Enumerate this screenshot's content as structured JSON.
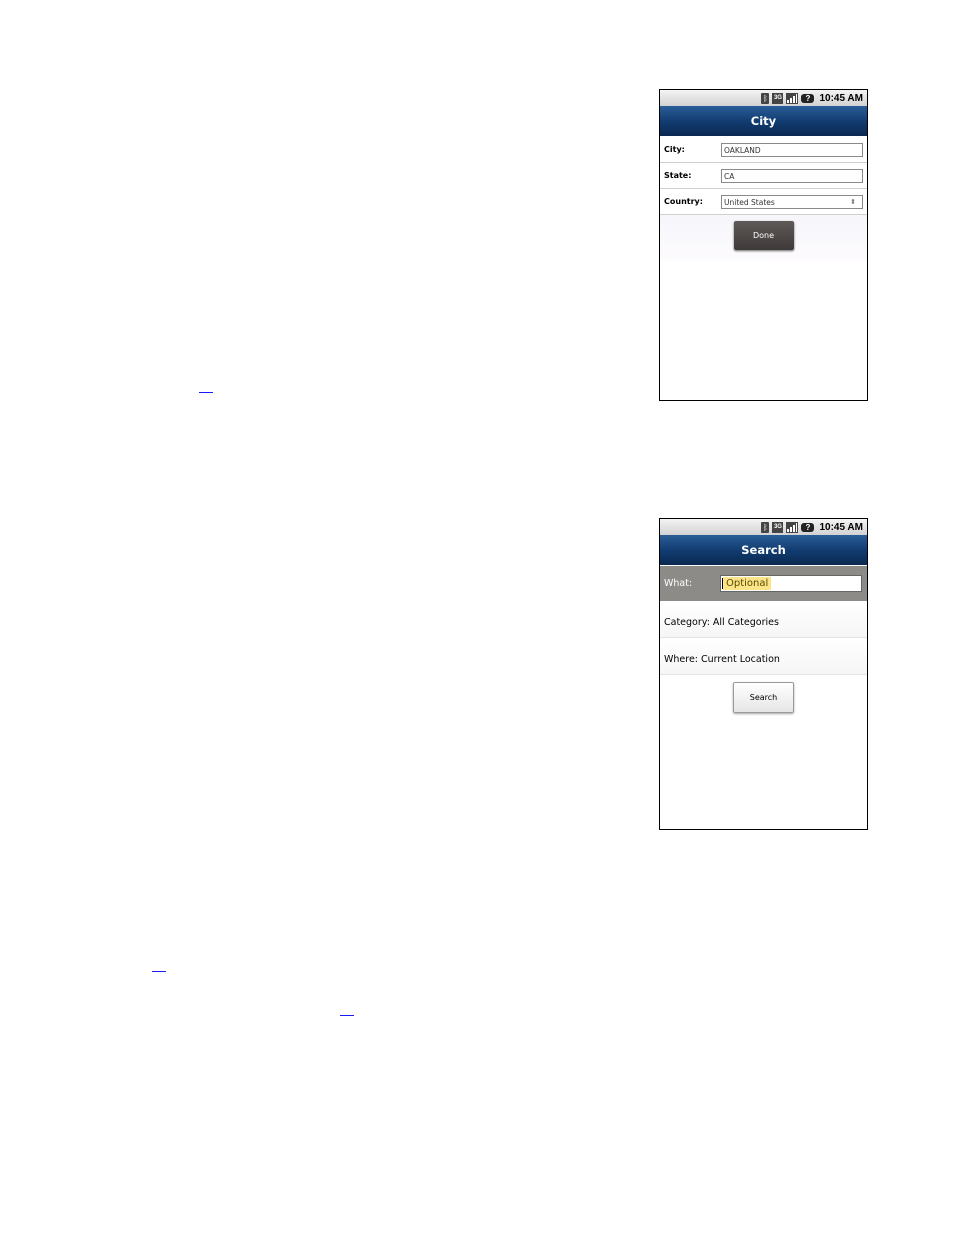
{
  "city_screen": {
    "status": {
      "time": "10:45 AM",
      "icons": [
        "bluetooth-icon",
        "3g-icon",
        "signal-icon",
        "unknown-icon"
      ]
    },
    "title": "City",
    "fields": [
      {
        "label": "City:",
        "value": "OAKLAND"
      },
      {
        "label": "State:",
        "value": "CA"
      },
      {
        "label": "Country:",
        "value": "United States"
      }
    ],
    "done_label": "Done"
  },
  "search_screen": {
    "status": {
      "time": "10:45 AM"
    },
    "title": "Search",
    "what_label": "What:",
    "what_placeholder": "Optional",
    "category_text": "Category: All Categories",
    "where_text": "Where: Current Location",
    "search_label": "Search"
  },
  "colors": {
    "title_bar": "#123d72",
    "what_row": "#8d8b88",
    "highlight": "#fce488",
    "footnote_link": "#1a1aff"
  }
}
